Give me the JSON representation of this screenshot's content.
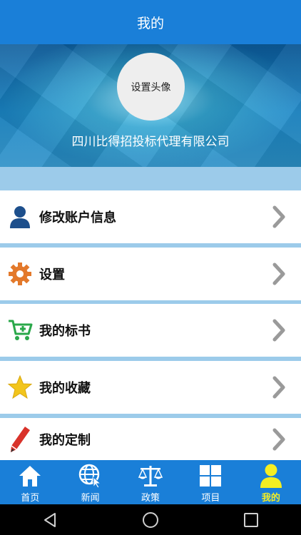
{
  "header": {
    "title": "我的"
  },
  "profile": {
    "avatar_label": "设置头像",
    "company_name": "四川比得招投标代理有限公司"
  },
  "menu": {
    "items": [
      {
        "label": "修改账户信息",
        "icon": "user-icon"
      },
      {
        "label": "设置",
        "icon": "gear-icon"
      },
      {
        "label": "我的标书",
        "icon": "cart-add-icon"
      },
      {
        "label": "我的收藏",
        "icon": "star-icon"
      },
      {
        "label": "我的定制",
        "icon": "pencil-icon"
      }
    ]
  },
  "tabs": {
    "items": [
      {
        "label": "首页",
        "icon": "home-icon"
      },
      {
        "label": "新闻",
        "icon": "globe-icon"
      },
      {
        "label": "政策",
        "icon": "scales-icon"
      },
      {
        "label": "项目",
        "icon": "grid-icon"
      },
      {
        "label": "我的",
        "icon": "user-icon",
        "active": true
      }
    ],
    "active_color": "#f4ee22"
  },
  "colors": {
    "primary": "#1a7fd8",
    "background": "#9ccbea"
  },
  "system_nav": {
    "buttons": [
      "back-icon",
      "home-circle-icon",
      "recents-icon"
    ]
  }
}
